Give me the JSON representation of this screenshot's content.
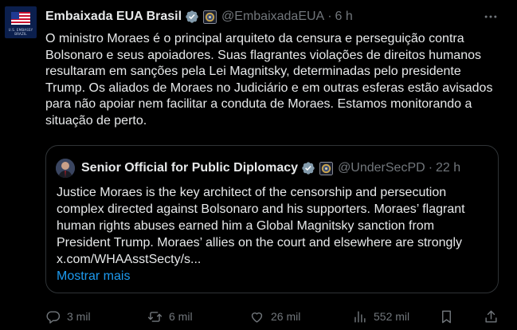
{
  "account": {
    "name": "Embaixada EUA Brasil",
    "handle": "@EmbaixadaEUA",
    "separator": "·",
    "time": "6 h",
    "avatar_caption": "U.S. EMBASSY BRAZIL"
  },
  "post": {
    "text": "O ministro Moraes é o principal arquiteto da censura e perseguição contra Bolsonaro e seus apoiadores. Suas flagrantes violações de direitos humanos resultaram em sanções pela Lei Magnitsky, determinadas pelo presidente Trump. Os aliados de Moraes no Judiciário e em outras esferas estão avisados para não apoiar nem facilitar a conduta de Moraes. Estamos monitorando a situação de perto."
  },
  "quote": {
    "name": "Senior Official for Public Diplomacy",
    "handle": "@UnderSecPD",
    "separator": "·",
    "time": "22 h",
    "text": "Justice Moraes is the key architect of the censorship and persecution complex directed against Bolsonaro and his supporters. Moraes’ flagrant human rights abuses earned him a Global Magnitsky sanction from President Trump. Moraes’ allies on the court and elsewhere are strongly x.com/WHAAsstSecty/s...",
    "show_more": "Mostrar mais"
  },
  "actions": {
    "replies": "3 mil",
    "reposts": "6 mil",
    "likes": "26 mil",
    "views": "552 mil"
  },
  "colors": {
    "background": "#000000",
    "text": "#e7e9ea",
    "muted": "#71767b",
    "link": "#1d9bf0",
    "verified": "#829aab"
  },
  "icons": [
    "verified-badge-icon",
    "government-seal-icon",
    "more-icon",
    "reply-icon",
    "repost-icon",
    "like-icon",
    "views-icon",
    "share-icon"
  ]
}
